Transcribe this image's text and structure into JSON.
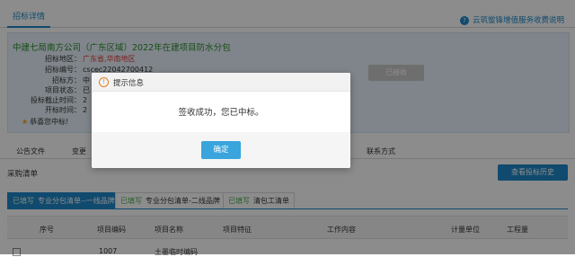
{
  "header": {
    "active_tab": "招标详情",
    "service_link": "云筑鲎锋增值服务收费说明",
    "service_icon": "?"
  },
  "project": {
    "title": "中建七局南方公司（广东区域）2022年在建项目防水分包",
    "fields": [
      {
        "label": "招标地区：",
        "value": "广东省,华南地区"
      },
      {
        "label": "招标编号：",
        "value": "cscec22042700412"
      },
      {
        "label": "招标方：",
        "value": "中"
      },
      {
        "label": "项目状态：",
        "value": "已"
      },
      {
        "label": "投标截止时间：",
        "value": "2"
      },
      {
        "label": "开标时间：",
        "value": "2"
      }
    ],
    "received_button": "已接收",
    "won_text": "恭喜您中标!"
  },
  "sub_tabs": [
    "公告文件",
    "变更",
    "联系方式"
  ],
  "purchase": {
    "title": "采购清单",
    "history_button": "查看投标历史",
    "list_tabs": [
      {
        "status": "已填写",
        "label": "专业分包清单--一线品牌",
        "active": true
      },
      {
        "status": "已填写",
        "label": "专业分包清单-二线品牌",
        "active": false
      },
      {
        "status": "已填写",
        "label": "清包工清单",
        "active": false
      }
    ],
    "columns": [
      "序号",
      "项目编码",
      "项目名称",
      "项目特征",
      "工作内容",
      "计量单位",
      "工程量"
    ],
    "rows": [
      {
        "code": "1007",
        "name": "土墨临时编码"
      }
    ]
  },
  "dialog": {
    "title": "提示信息",
    "icon": "!",
    "message": "签收成功，您已中标。",
    "ok_button": "确定"
  },
  "colors": {
    "primary": "#1e88c8",
    "title_green": "#2e8b2e",
    "warning_orange": "#e67e22",
    "info_bg": "#e7f3fb"
  }
}
